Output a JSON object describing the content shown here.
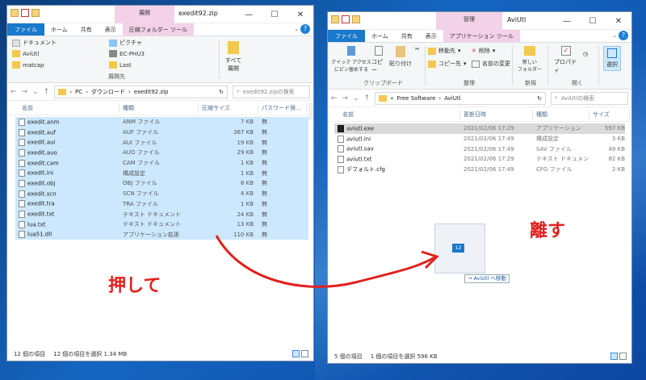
{
  "left": {
    "title": "exedit92.zip",
    "ctx_group": "展開",
    "tabs": [
      "ファイル",
      "ホーム",
      "共有",
      "表示",
      "圧縮フォルダー ツール"
    ],
    "ribbon_items": [
      "ドキュメント",
      "AviUtl",
      "matcap",
      "ピクチャ",
      "EC-PHU3",
      "Last"
    ],
    "extract_all": "すべて展開",
    "ribbon_group": "展開先",
    "path": [
      "PC",
      "ダウンロード",
      "exedit92.zip"
    ],
    "search_placeholder": "exedit92.zipの検索",
    "columns": [
      "名前",
      "種類",
      "圧縮サイズ",
      "パスワード保..."
    ],
    "files": [
      {
        "name": "exedit.anm",
        "type": "ANM ファイル",
        "size": "7 KB",
        "pw": "無"
      },
      {
        "name": "exedit.auf",
        "type": "AUF ファイル",
        "size": "367 KB",
        "pw": "無"
      },
      {
        "name": "exedit.aui",
        "type": "AUI ファイル",
        "size": "19 KB",
        "pw": "無"
      },
      {
        "name": "exedit.auo",
        "type": "AUO ファイル",
        "size": "29 KB",
        "pw": "無"
      },
      {
        "name": "exedit.cam",
        "type": "CAM ファイル",
        "size": "1 KB",
        "pw": "無"
      },
      {
        "name": "exedit.ini",
        "type": "構成設定",
        "size": "1 KB",
        "pw": "無"
      },
      {
        "name": "exedit.obj",
        "type": "OBJ ファイル",
        "size": "8 KB",
        "pw": "無"
      },
      {
        "name": "exedit.scn",
        "type": "SCN ファイル",
        "size": "4 KB",
        "pw": "無"
      },
      {
        "name": "exedit.tra",
        "type": "TRA ファイル",
        "size": "1 KB",
        "pw": "無"
      },
      {
        "name": "exedit.txt",
        "type": "テキスト ドキュメント",
        "size": "24 KB",
        "pw": "無"
      },
      {
        "name": "lua.txt",
        "type": "テキスト ドキュメント",
        "size": "13 KB",
        "pw": "無"
      },
      {
        "name": "lua51.dll",
        "type": "アプリケーション拡張",
        "size": "110 KB",
        "pw": "無"
      }
    ],
    "status_count": "12 個の項目",
    "status_sel": "12 個の項目を選択  1.34 MB"
  },
  "right": {
    "title": "AviUtl",
    "ctx_group": "管理",
    "tabs": [
      "ファイル",
      "ホーム",
      "共有",
      "表示",
      "アプリケーション ツール"
    ],
    "quick_access": "クイック アクセス\nにピン留めする",
    "copy": "コピー",
    "paste": "貼り付け",
    "group_clipboard": "クリップボード",
    "move_to": "移動先",
    "copy_to": "コピー先",
    "delete": "削除",
    "rename": "名前の変更",
    "group_organize": "整理",
    "new_folder": "新しい\nフォルダー",
    "group_new": "新規",
    "properties": "プロパティ",
    "group_open": "開く",
    "select": "選択",
    "path": [
      "Free Software",
      "AviUtl"
    ],
    "search_placeholder": "AviUtlの検索",
    "columns": [
      "名前",
      "更新日時",
      "種類",
      "サイズ"
    ],
    "files": [
      {
        "name": "aviutl.exe",
        "date": "2021/02/06 17:29",
        "type": "アプリケーション",
        "size": "597 KB"
      },
      {
        "name": "aviutl.ini",
        "date": "2021/02/06 17:49",
        "type": "構成設定",
        "size": "3 KB"
      },
      {
        "name": "aviutl.sav",
        "date": "2021/02/06 17:49",
        "type": "SAV ファイル",
        "size": "49 KB"
      },
      {
        "name": "aviutl.txt",
        "date": "2021/02/06 17:29",
        "type": "テキスト ドキュメント",
        "size": "82 KB"
      },
      {
        "name": "デフォルト.cfg",
        "date": "2021/02/06 17:49",
        "type": "CFG ファイル",
        "size": "2 KB"
      }
    ],
    "status_count": "5 個の項目",
    "status_sel": "1 個の項目を選択  596 KB"
  },
  "drag": {
    "badge": "12",
    "tip": "→ AviUtl へ移動"
  },
  "annotations": {
    "press": "押して",
    "release": "離す"
  }
}
